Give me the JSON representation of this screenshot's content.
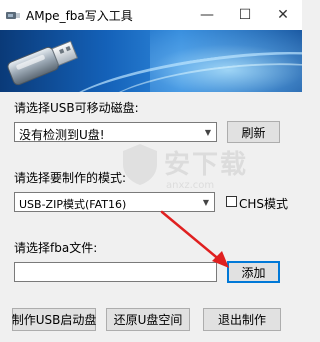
{
  "window": {
    "title": "AMpe_fba写入工具",
    "minimize_glyph": "—",
    "maximize_glyph": "☐",
    "close_glyph": "✕"
  },
  "usb_section": {
    "label": "请选择USB可移动磁盘:",
    "selected": "没有检测到U盘!",
    "refresh_label": "刷新"
  },
  "mode_section": {
    "label": "请选择要制作的模式:",
    "selected": "USB-ZIP模式(FAT16)",
    "chs_label": "CHS模式",
    "chs_checked": false
  },
  "file_section": {
    "label": "请选择fba文件:",
    "path_value": "",
    "add_label": "添加"
  },
  "bottom_buttons": {
    "make_label": "制作USB启动盘",
    "restore_label": "还原U盘空间",
    "exit_label": "退出制作"
  },
  "watermark": {
    "text": "安下载",
    "sub": "anxz.com"
  },
  "colors": {
    "annotation_arrow": "#e02020",
    "focus_border": "#0078d7",
    "banner_dark": "#0a3a78",
    "banner_light": "#2d86da"
  }
}
